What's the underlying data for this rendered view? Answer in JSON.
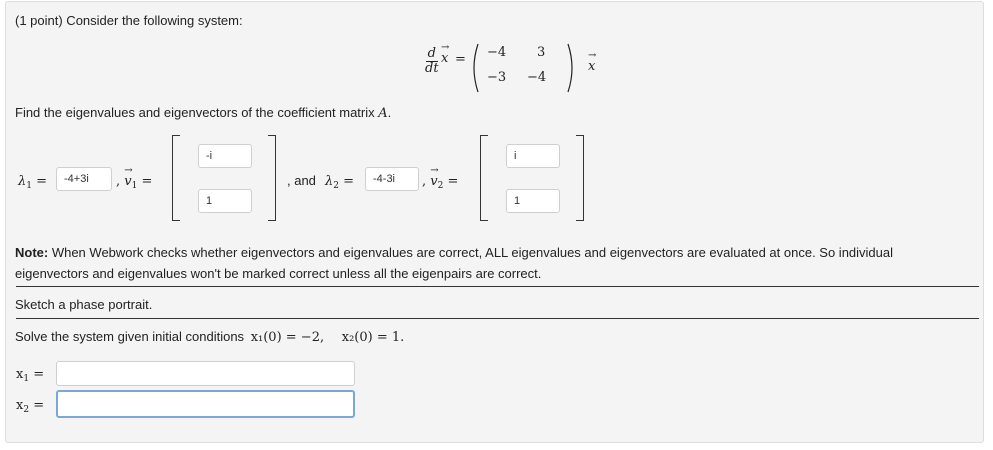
{
  "header": "(1 point) Consider the following system:",
  "system": {
    "lhs_d": "d",
    "lhs_dt": "dt",
    "vec_symbol": "x",
    "arrow": "→",
    "equals": "=",
    "matrix": [
      [
        "−4",
        "3"
      ],
      [
        "−3",
        "−4"
      ]
    ],
    "rhs_vec": "x"
  },
  "instruction": "Find the eigenvalues and eigenvectors of the coefficient matrix",
  "matrix_symbol": "A",
  "lambda1_label": "λ",
  "lambda1_sub": "1",
  "lambda1_value": "-4+3i",
  "v1_label": "v",
  "v1_sub": "1",
  "v1_entries": [
    "-i",
    "1"
  ],
  "and_text": ", and",
  "lambda2_label": "λ",
  "lambda2_sub": "2",
  "lambda2_value": "-4-3i",
  "v2_label": "v",
  "v2_sub": "2",
  "v2_entries": [
    "i",
    "1"
  ],
  "note_bold": "Note:",
  "note_line1": " When Webwork checks whether eigenvectors and eigenvalues are correct, ALL eigenvalues and eigenvectors are evaluated at once. So individual",
  "note_line2": "eigenvectors and eigenvalues won't be marked correct unless all the eigenpairs are correct.",
  "sketch_text": "Sketch a phase portrait.",
  "solve_text": "Solve the system given initial conditions",
  "ic1": "x₁(0) = −2,",
  "ic2": "x₂(0) = 1.",
  "x1_label": "x",
  "x1_sub": "1",
  "x1_value": "",
  "x2_label": "x",
  "x2_sub": "2",
  "x2_value": ""
}
